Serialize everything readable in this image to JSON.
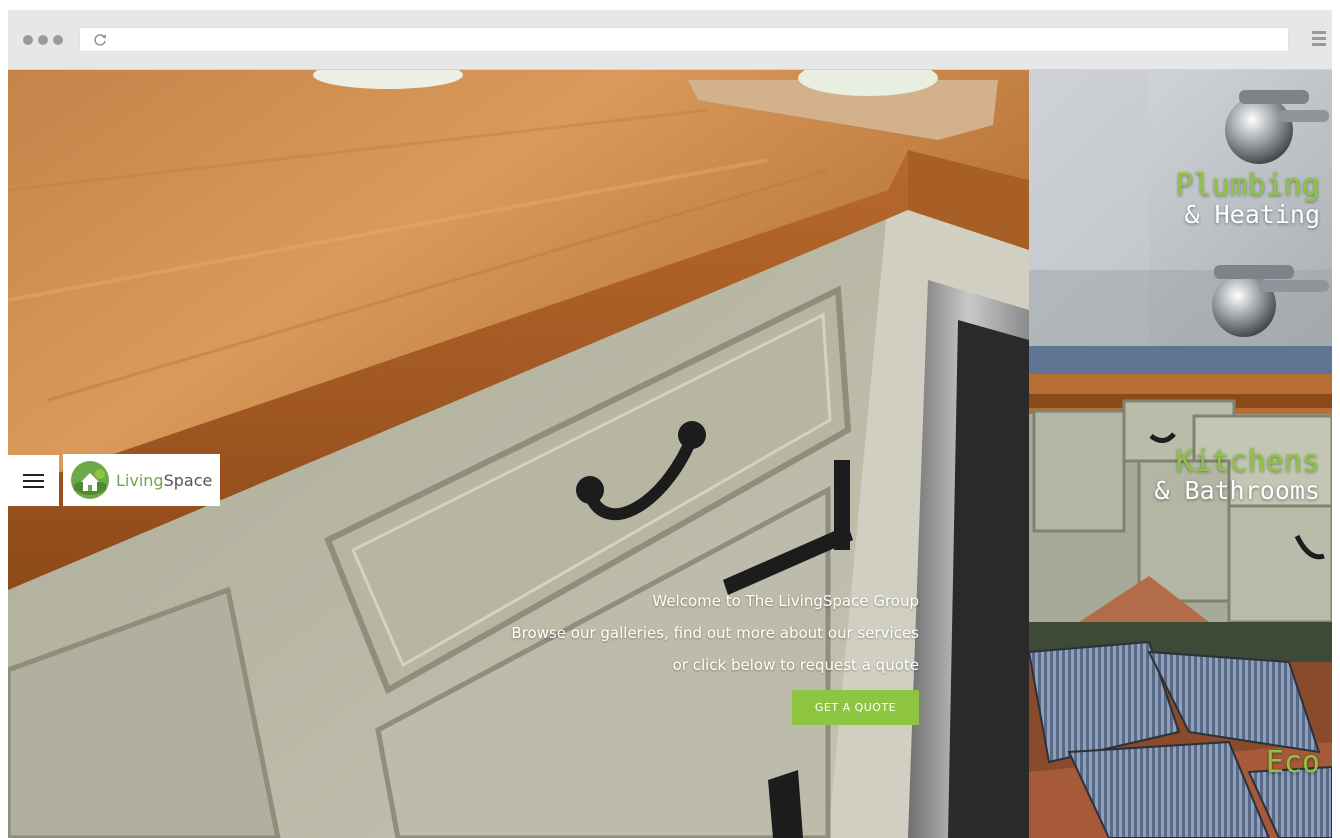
{
  "browser": {
    "address": "",
    "icons": [
      "reload-icon",
      "hamburger-menu-icon"
    ]
  },
  "brand": {
    "name_part1": "Living",
    "name_part2": "Space",
    "colors": {
      "accent": "#8dc540",
      "logo_green": "#6fa84a"
    }
  },
  "hero": {
    "lines": [
      "Welcome to The LivingSpace Group",
      "Browse our galleries, find out more about our services",
      "or click below to request a quote"
    ],
    "cta_label": "GET A QUOTE"
  },
  "panels": [
    {
      "title": "Plumbing",
      "subtitle": "& Heating"
    },
    {
      "title": "Kitchens",
      "subtitle": "& Bathrooms"
    },
    {
      "title": "Eco"
    }
  ]
}
